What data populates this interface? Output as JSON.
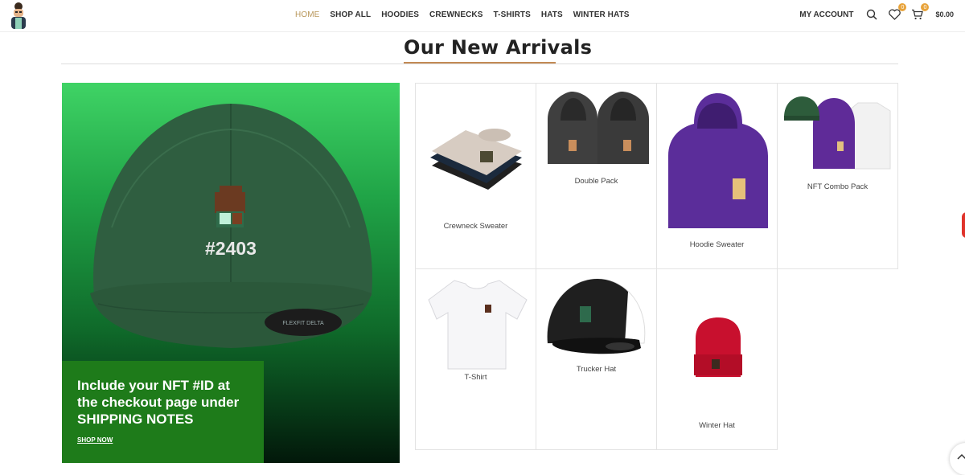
{
  "header": {
    "nav": [
      "HOME",
      "SHOP ALL",
      "HOODIES",
      "CREWNECKS",
      "T-SHIRTS",
      "HATS",
      "WINTER HATS"
    ],
    "active_nav": "HOME",
    "account_label": "MY ACCOUNT",
    "wishlist_count": "0",
    "cart_count": "0",
    "cart_total": "$0.00",
    "icons": [
      "logo-avatar-icon",
      "search-icon",
      "heart-icon",
      "cart-icon"
    ]
  },
  "section": {
    "title": "Our New Arrivals"
  },
  "hero": {
    "cap_number": "#2403",
    "cap_brand": "FLEXFIT DELTA",
    "promo_text": "Include your NFT #ID at the checkout page under SHIPPING NOTES",
    "shop_now": "SHOP NOW"
  },
  "products": [
    {
      "name": "Crewneck Sweater"
    },
    {
      "name": "Double Pack"
    },
    {
      "name": "Hoodie Sweater"
    },
    {
      "name": "NFT Combo Pack"
    },
    {
      "name": "T-Shirt"
    },
    {
      "name": "Trucker Hat"
    },
    {
      "name": "Winter Hat"
    }
  ],
  "colors": {
    "accent": "#b8975a",
    "title_underline": "#c38a55",
    "promo_bg": "#1e7b1a",
    "badge": "#e8a33a"
  }
}
